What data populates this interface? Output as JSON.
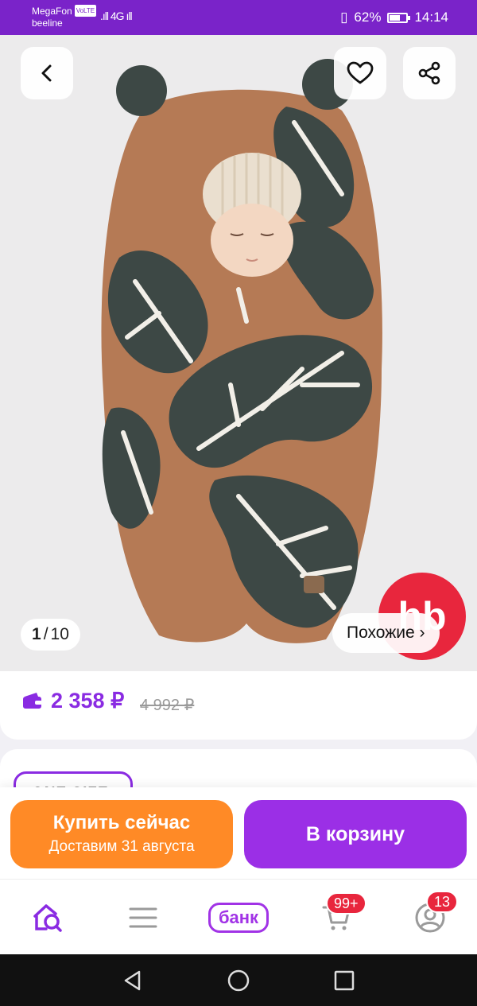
{
  "status_bar": {
    "carrier1": "MegaFon",
    "carrier1_tag": "VoLTE",
    "carrier2": "beeline",
    "signal": ".ıll 4G ıll",
    "battery_percent": "62%",
    "battery_level": 0.62,
    "time": "14:14"
  },
  "gallery": {
    "counter_current": "1",
    "counter_sep": "/",
    "counter_total": "10",
    "similar_label": "Похожие ›",
    "brand_logo": "hb"
  },
  "price": {
    "current": "2 358 ₽",
    "old": "4 992 ₽"
  },
  "sizes": {
    "selected": "ONE SIZE"
  },
  "actions": {
    "buy_now": "Купить сейчас",
    "delivery": "Доставим 31 августа",
    "add_to_cart": "В корзину"
  },
  "tabbar": {
    "bank_label": "банк",
    "cart_badge": "99+",
    "profile_badge": "13"
  },
  "colors": {
    "accent": "#8a2be2",
    "buy": "#ff8a26",
    "cart": "#9b2fe6",
    "badge": "#e8263d"
  }
}
